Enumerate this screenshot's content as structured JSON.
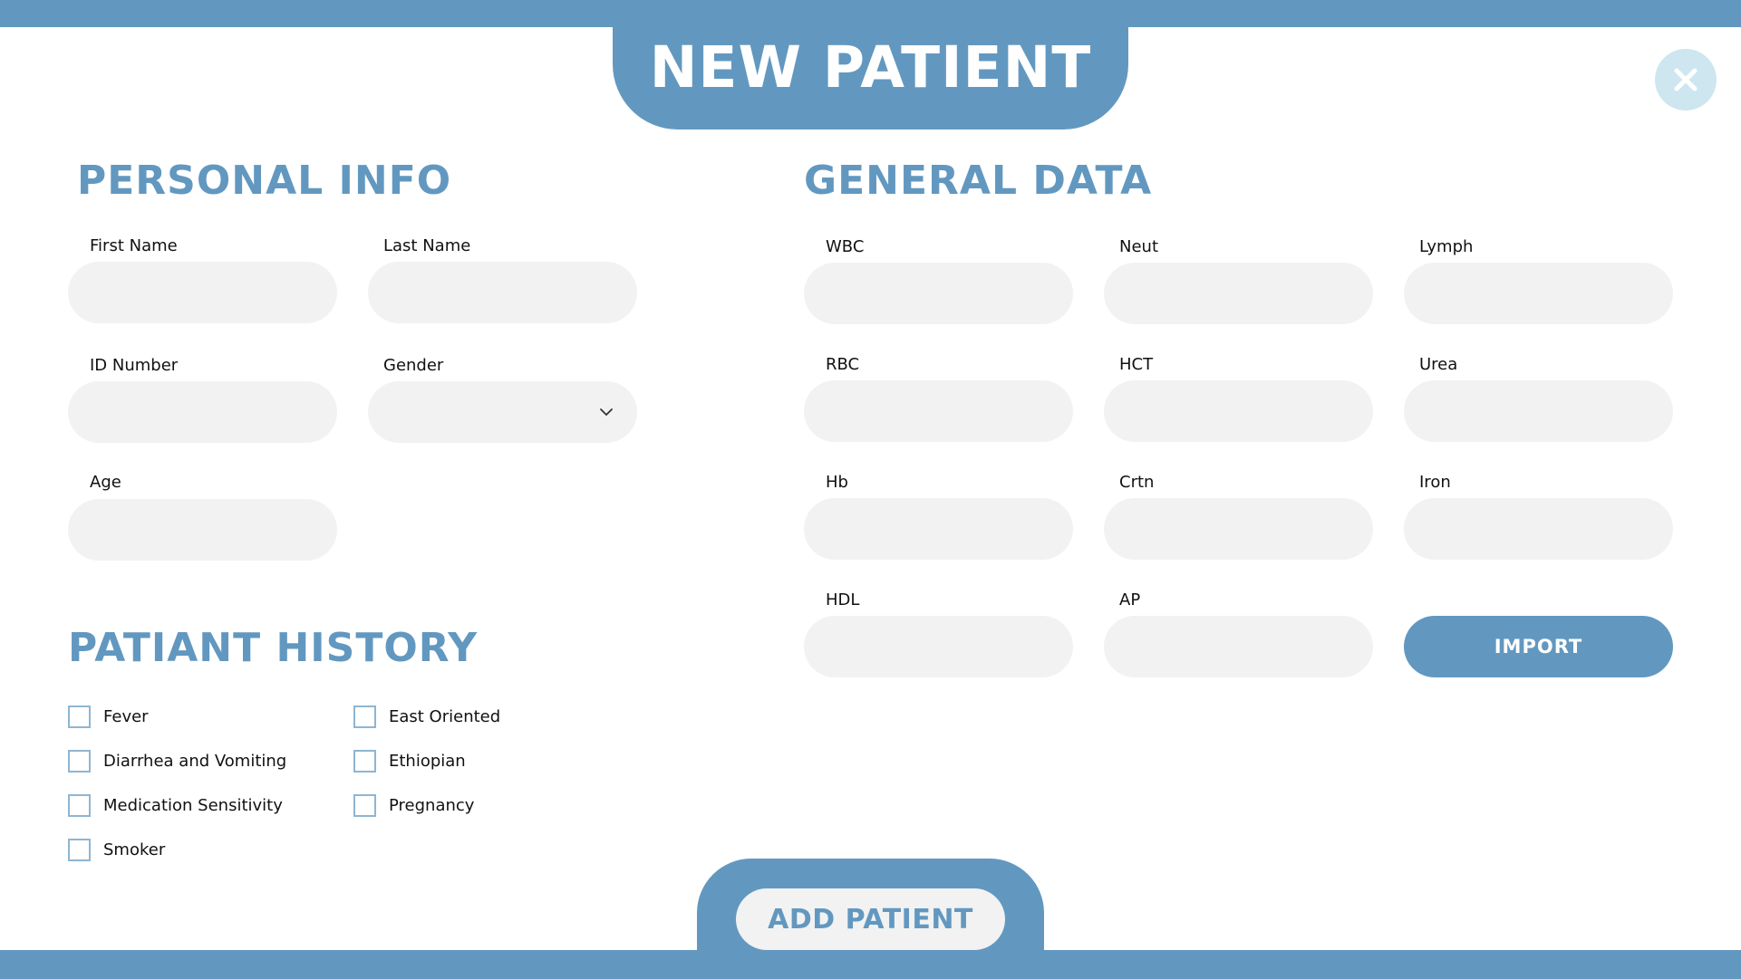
{
  "header": {
    "title": "NEW PATIENT",
    "close_icon": "close-icon"
  },
  "personal_info": {
    "title": "PERSONAL INFO",
    "first_name": {
      "label": "First Name",
      "value": ""
    },
    "last_name": {
      "label": "Last Name",
      "value": ""
    },
    "id_number": {
      "label": "ID Number",
      "value": ""
    },
    "gender": {
      "label": "Gender",
      "value": ""
    },
    "age": {
      "label": "Age",
      "value": ""
    }
  },
  "general_data": {
    "title": "GENERAL DATA",
    "wbc": {
      "label": "WBC",
      "value": ""
    },
    "neut": {
      "label": "Neut",
      "value": ""
    },
    "lymph": {
      "label": "Lymph",
      "value": ""
    },
    "rbc": {
      "label": "RBC",
      "value": ""
    },
    "hct": {
      "label": "HCT",
      "value": ""
    },
    "urea": {
      "label": "Urea",
      "value": ""
    },
    "hb": {
      "label": "Hb",
      "value": ""
    },
    "crtn": {
      "label": "Crtn",
      "value": ""
    },
    "iron": {
      "label": "Iron",
      "value": ""
    },
    "hdl": {
      "label": "HDL",
      "value": ""
    },
    "ap": {
      "label": "AP",
      "value": ""
    },
    "import_label": "IMPORT"
  },
  "history": {
    "title": "PATIANT HISTORY",
    "items": [
      {
        "label": "Fever",
        "checked": true
      },
      {
        "label": "Diarrhea and Vomiting",
        "checked": false
      },
      {
        "label": "Medication Sensitivity",
        "checked": false
      },
      {
        "label": "Smoker",
        "checked": false
      },
      {
        "label": "East Oriented",
        "checked": false
      },
      {
        "label": "Ethiopian",
        "checked": false
      },
      {
        "label": "Pregnancy",
        "checked": false
      }
    ]
  },
  "footer": {
    "add_label": "ADD PATIENT"
  },
  "colors": {
    "accent": "#6298c0",
    "field_bg": "#f1f2f1",
    "close_bg": "#cde6ef"
  }
}
